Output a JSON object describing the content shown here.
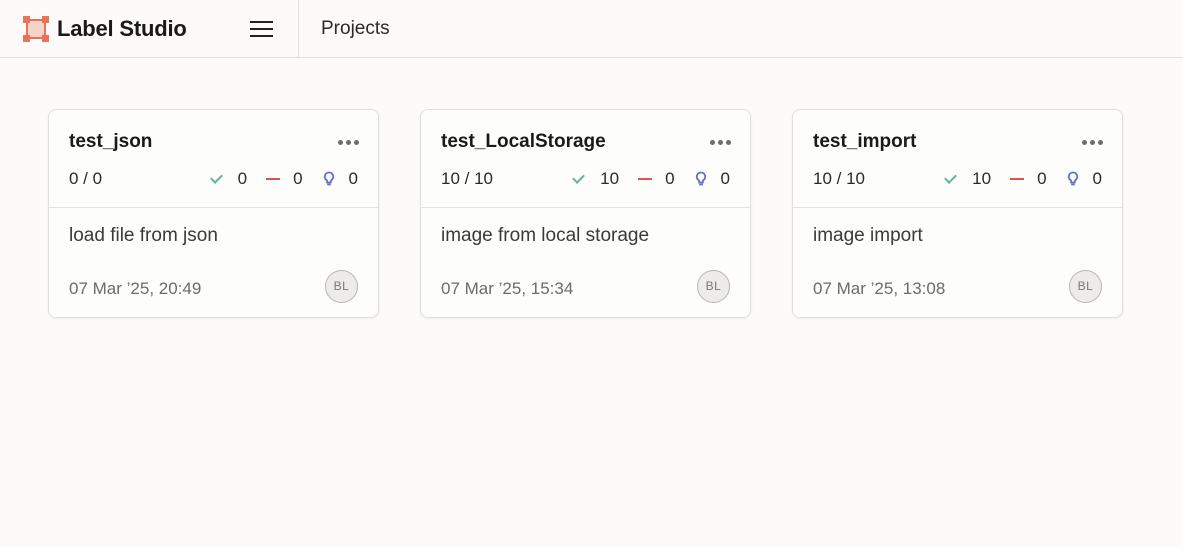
{
  "app": {
    "name": "Label Studio",
    "breadcrumb": "Projects",
    "colors": {
      "brand": "#e8735a",
      "completed": "#5fb59a",
      "skipped": "#d9534f",
      "predictions": "#6270c9"
    }
  },
  "projects": [
    {
      "title": "test_json",
      "progress": "0 / 0",
      "completed": "0",
      "skipped": "0",
      "predictions": "0",
      "description": "load file from json",
      "created": "07 Mar ’25, 20:49",
      "owner_initials": "BL"
    },
    {
      "title": "test_LocalStorage",
      "progress": "10 / 10",
      "completed": "10",
      "skipped": "0",
      "predictions": "0",
      "description": "image from local storage",
      "created": "07 Mar ’25, 15:34",
      "owner_initials": "BL"
    },
    {
      "title": "test_import",
      "progress": "10 / 10",
      "completed": "10",
      "skipped": "0",
      "predictions": "0",
      "description": "image import",
      "created": "07 Mar ’25, 13:08",
      "owner_initials": "BL"
    }
  ]
}
